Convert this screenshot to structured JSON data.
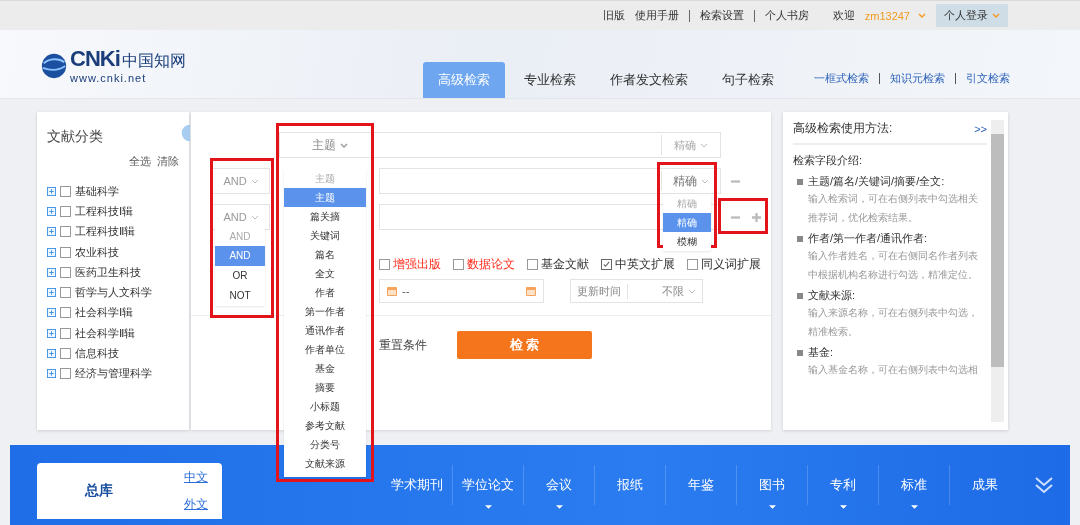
{
  "top_bar": {
    "links": [
      "旧版",
      "使用手册",
      "检索设置",
      "个人书房"
    ],
    "welcome": "欢迎",
    "username": "zm13247",
    "login_button": "个人登录"
  },
  "header": {
    "logo": {
      "mark": "CNKi",
      "name": "中国知网",
      "url": "www.cnki.net"
    },
    "tabs": [
      {
        "label": "高级检索",
        "selected": true
      },
      {
        "label": "专业检索",
        "selected": false
      },
      {
        "label": "作者发文检索",
        "selected": false
      },
      {
        "label": "句子检索",
        "selected": false
      }
    ],
    "links": [
      "一框式检索",
      "知识元检索",
      "引文检索"
    ]
  },
  "sidebar": {
    "title": "文献分类",
    "select_all": "全选",
    "clear": "清除",
    "items": [
      {
        "label": "基础科学",
        "checked": false
      },
      {
        "label": "工程科技Ⅰ辑",
        "checked": false
      },
      {
        "label": "工程科技Ⅱ辑",
        "checked": false
      },
      {
        "label": "农业科技",
        "checked": false
      },
      {
        "label": "医药卫生科技",
        "checked": false
      },
      {
        "label": "哲学与人文科学",
        "checked": false
      },
      {
        "label": "社会科学Ⅰ辑",
        "checked": false
      },
      {
        "label": "社会科学Ⅱ辑",
        "checked": false
      },
      {
        "label": "信息科技",
        "checked": false
      },
      {
        "label": "经济与管理科学",
        "checked": false
      }
    ]
  },
  "search_form": {
    "rows": [
      {
        "field": "主题",
        "match": "精确",
        "removable": false,
        "addable": false
      },
      {
        "logic": "AND",
        "match": "精确",
        "removable": true,
        "addable": false
      },
      {
        "logic": "AND",
        "removable": true,
        "addable": true
      }
    ],
    "logic_dropdown": {
      "header": "AND",
      "options": [
        {
          "label": "AND",
          "selected": true
        },
        {
          "label": "OR",
          "selected": false
        },
        {
          "label": "NOT",
          "selected": false
        }
      ]
    },
    "field_dropdown": {
      "header": "主题",
      "options": [
        {
          "label": "主题",
          "selected": true
        },
        {
          "label": "篇关摘",
          "selected": false
        },
        {
          "label": "关键词",
          "selected": false
        },
        {
          "label": "篇名",
          "selected": false
        },
        {
          "label": "全文",
          "selected": false
        },
        {
          "label": "作者",
          "selected": false
        },
        {
          "label": "第一作者",
          "selected": false
        },
        {
          "label": "通讯作者",
          "selected": false
        },
        {
          "label": "作者单位",
          "selected": false
        },
        {
          "label": "基金",
          "selected": false
        },
        {
          "label": "摘要",
          "selected": false
        },
        {
          "label": "小标题",
          "selected": false
        },
        {
          "label": "参考文献",
          "selected": false
        },
        {
          "label": "分类号",
          "selected": false
        },
        {
          "label": "文献来源",
          "selected": false
        }
      ]
    },
    "match_dropdown": {
      "header": "精确",
      "options": [
        {
          "label": "精确",
          "selected": true
        },
        {
          "label": "模糊",
          "selected": false
        }
      ]
    },
    "options": [
      {
        "label": "增强出版",
        "checked": false,
        "highlight": true
      },
      {
        "label": "数据论文",
        "checked": false,
        "highlight": true
      },
      {
        "label": "基金文献",
        "checked": false,
        "highlight": false
      },
      {
        "label": "中英文扩展",
        "checked": true,
        "highlight": false
      },
      {
        "label": "同义词扩展",
        "checked": false,
        "highlight": false
      }
    ],
    "date_range": {
      "separator": "--"
    },
    "update_time": {
      "label": "更新时间",
      "value": "不限"
    },
    "reset": "重置条件",
    "search": "检 索"
  },
  "help": {
    "title": "高级检索使用方法:",
    "more": ">>",
    "intro": "检索字段介绍:",
    "sections": [
      {
        "heading": "主题/篇名/关键词/摘要/全文:",
        "text": "输入检索词，可在右侧列表中勾选相关推荐词，优化检索结果。"
      },
      {
        "heading": "作者/第一作者/通讯作者:",
        "text": "输入作者姓名，可在右侧同名作者列表中根据机构名称进行勾选，精准定位。"
      },
      {
        "heading": "文献来源:",
        "text": "输入来源名称，可在右侧列表中勾选，精准检索。"
      },
      {
        "heading": "基金:",
        "text": "输入基金名称，可在右侧列表中勾选相"
      }
    ]
  },
  "bottom_nav": {
    "main": "总库",
    "languages": [
      "中文",
      "外文"
    ],
    "items": [
      {
        "label": "学术期刊",
        "has_submenu": false
      },
      {
        "label": "学位论文",
        "has_submenu": true
      },
      {
        "label": "会议",
        "has_submenu": true
      },
      {
        "label": "报纸",
        "has_submenu": false
      },
      {
        "label": "年鉴",
        "has_submenu": false
      },
      {
        "label": "图书",
        "has_submenu": true
      },
      {
        "label": "专利",
        "has_submenu": true
      },
      {
        "label": "标准",
        "has_submenu": true
      },
      {
        "label": "成果",
        "has_submenu": false
      }
    ]
  }
}
